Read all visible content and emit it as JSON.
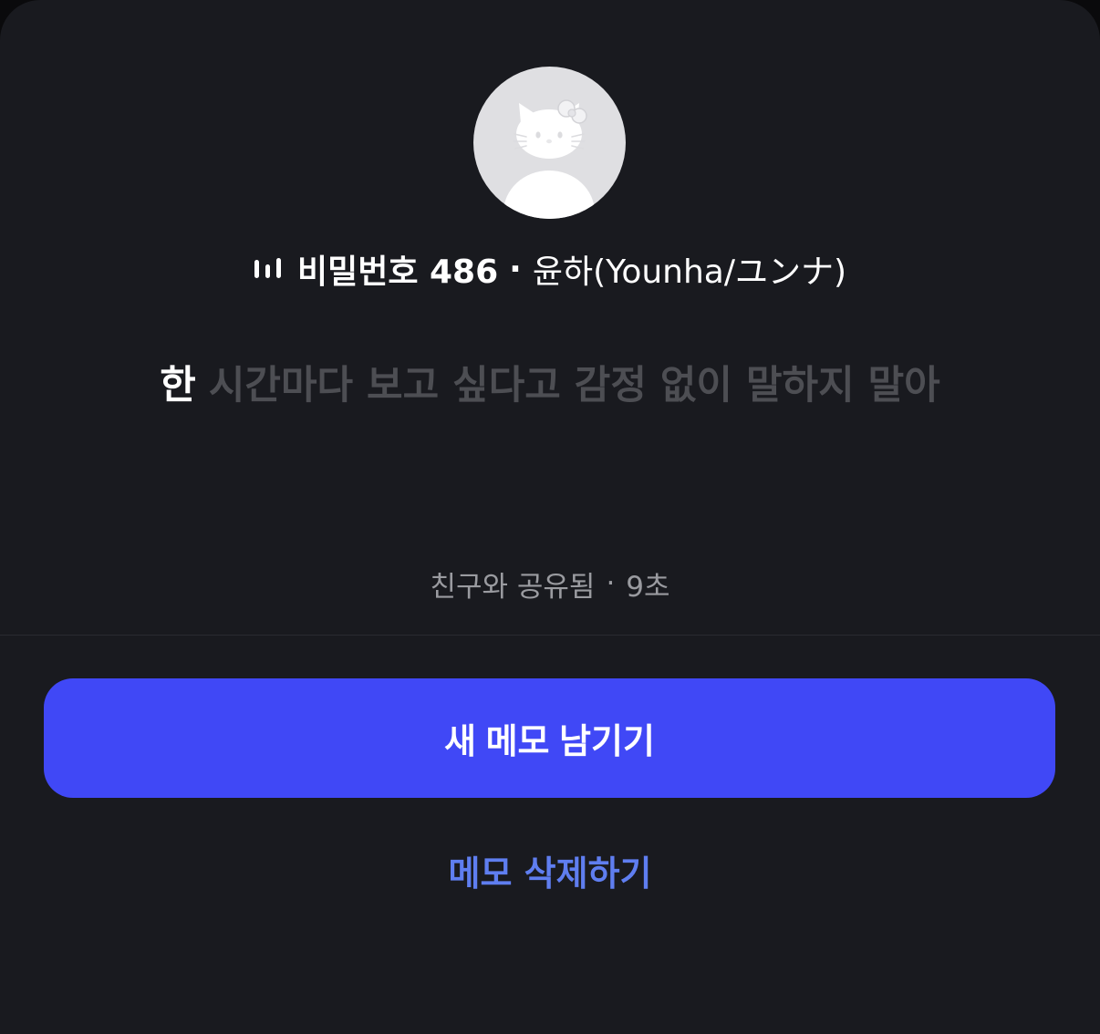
{
  "now_playing": {
    "song_title": "비밀번호 486",
    "separator": "·",
    "artist": "윤하(Younha/ユンナ)",
    "icon": "equalizer-icon"
  },
  "lyrics": {
    "active": "한",
    "upcoming": "시간마다 보고 싶다고 감정 없이 말하지 말아"
  },
  "status": {
    "shared_with": "친구와 공유됨",
    "separator": "·",
    "time_ago": "9초"
  },
  "actions": {
    "new_memo_label": "새 메모 남기기",
    "delete_memo_label": "메모 삭제하기"
  },
  "colors": {
    "background": "#191a1f",
    "primary_button": "#4048f6",
    "delete_text": "#5f7ef0",
    "muted_text": "#4d4e53"
  }
}
